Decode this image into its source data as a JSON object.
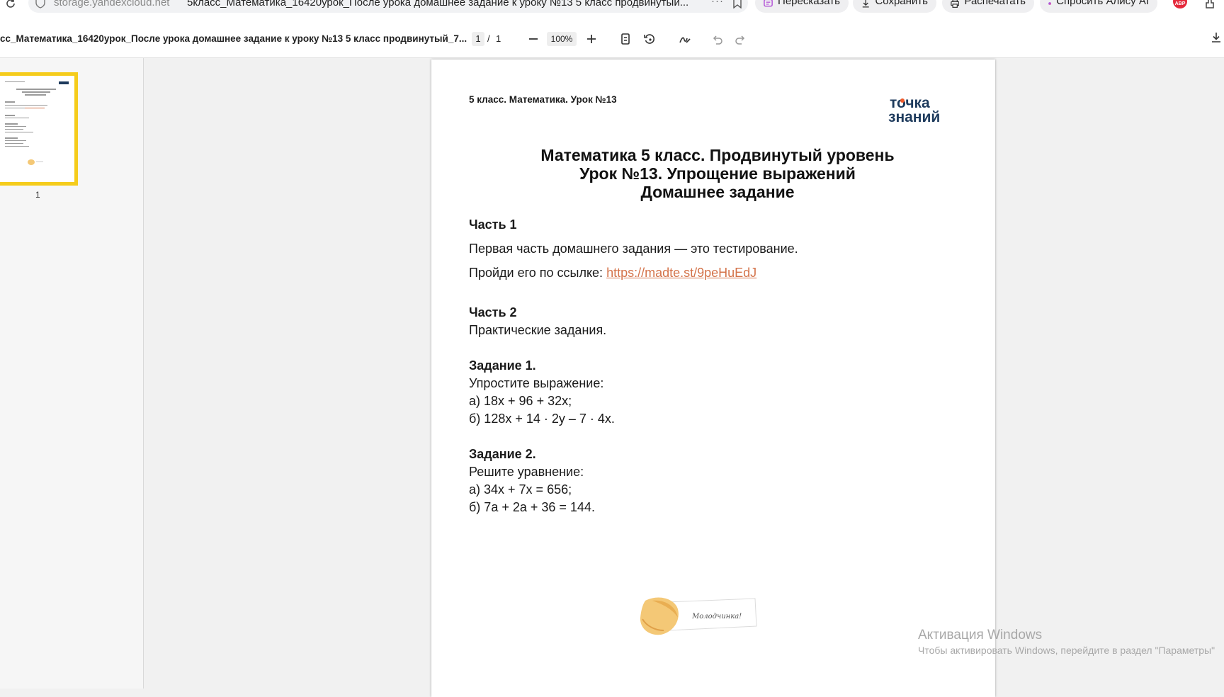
{
  "browser": {
    "url": "storage.yandexcloud.net",
    "tab_title": "5класс_Математика_16420урок_После урока домашнее задание к уроку №13 5 класс продвинутый...",
    "more": "···",
    "buttons": {
      "retell": "Пересказать",
      "save": "Сохранить",
      "print": "Распечатать",
      "alice": "Спросить Алису AI"
    },
    "abp_badge": "ABP",
    "icons": [
      "reload-icon",
      "shield-icon",
      "bookmark-icon",
      "download-icon",
      "printer-icon",
      "extensions-icon"
    ]
  },
  "pdf_toolbar": {
    "doc_name": "сс_Математика_16420урок_После урока домашнее задание к уроку №13 5 класс продвинутый_7...",
    "page_current": "1",
    "page_sep": "/",
    "page_total": "1",
    "zoom": "100%",
    "icons": [
      "zoom-out-icon",
      "zoom-in-icon",
      "fit-page-icon",
      "rotate-icon",
      "draw-icon",
      "undo-icon",
      "redo-icon",
      "download-icon"
    ]
  },
  "sidebar": {
    "thumbnail_page_label": "1"
  },
  "document": {
    "header": "5 класс. Математика. Урок №13",
    "logo_line1": "точка",
    "logo_line2": "знаний",
    "title_line1": "Математика 5 класс. Продвинутый уровень",
    "title_line2": "Урок №13. Упрощение выражений",
    "title_line3": "Домашнее задание",
    "part1_heading": "Часть 1",
    "part1_text": "Первая часть домашнего задания — это тестирование.",
    "part1_link_prefix": "Пройди его по ссылке: ",
    "part1_link": "https://madte.st/9peHuEdJ",
    "part2_heading": "Часть 2",
    "part2_text": "Практические задания.",
    "task1_heading": "Задание 1.",
    "task1_text": "Упростите выражение:",
    "task1_a": "а) 18х + 96 + 32х;",
    "task1_b": "б) 128х + 14 · 2у – 7 · 4х.",
    "task2_heading": "Задание 2.",
    "task2_text": "Решите уравнение:",
    "task2_a": "а) 34х + 7х = 656;",
    "task2_b": "б) 7а + 2а + 36 = 144.",
    "reward_text": "Молодчинка!"
  },
  "watermark": {
    "title": "Активация Windows",
    "subtitle": "Чтобы активировать Windows, перейдите в раздел \"Параметры\""
  }
}
